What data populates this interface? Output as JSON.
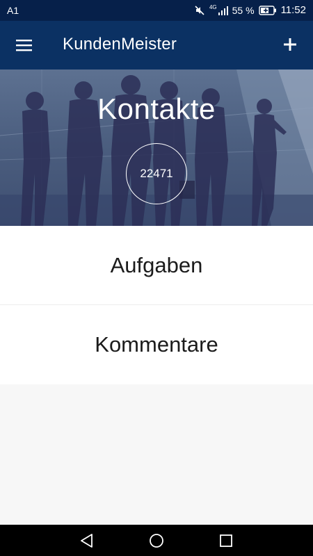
{
  "status_bar": {
    "carrier": "A1",
    "network": "4G",
    "battery": "55 %",
    "time": "11:52",
    "icons": [
      "mute-icon",
      "signal-icon",
      "battery-charging-icon"
    ]
  },
  "app_bar": {
    "title": "KundenMeister",
    "menu_icon": "hamburger-menu-icon",
    "add_icon": "plus-icon"
  },
  "hero": {
    "title": "Kontakte",
    "count": "22471"
  },
  "menu": {
    "aufgaben": "Aufgaben",
    "kommentare": "Kommentare"
  },
  "nav_bar": {
    "icons": [
      "back-icon",
      "home-icon",
      "recent-apps-icon"
    ]
  },
  "colors": {
    "status_bar": "#06204a",
    "app_bar": "#0b3163",
    "hero_overlay": "#4c5f80",
    "background": "#f7f7f7"
  }
}
